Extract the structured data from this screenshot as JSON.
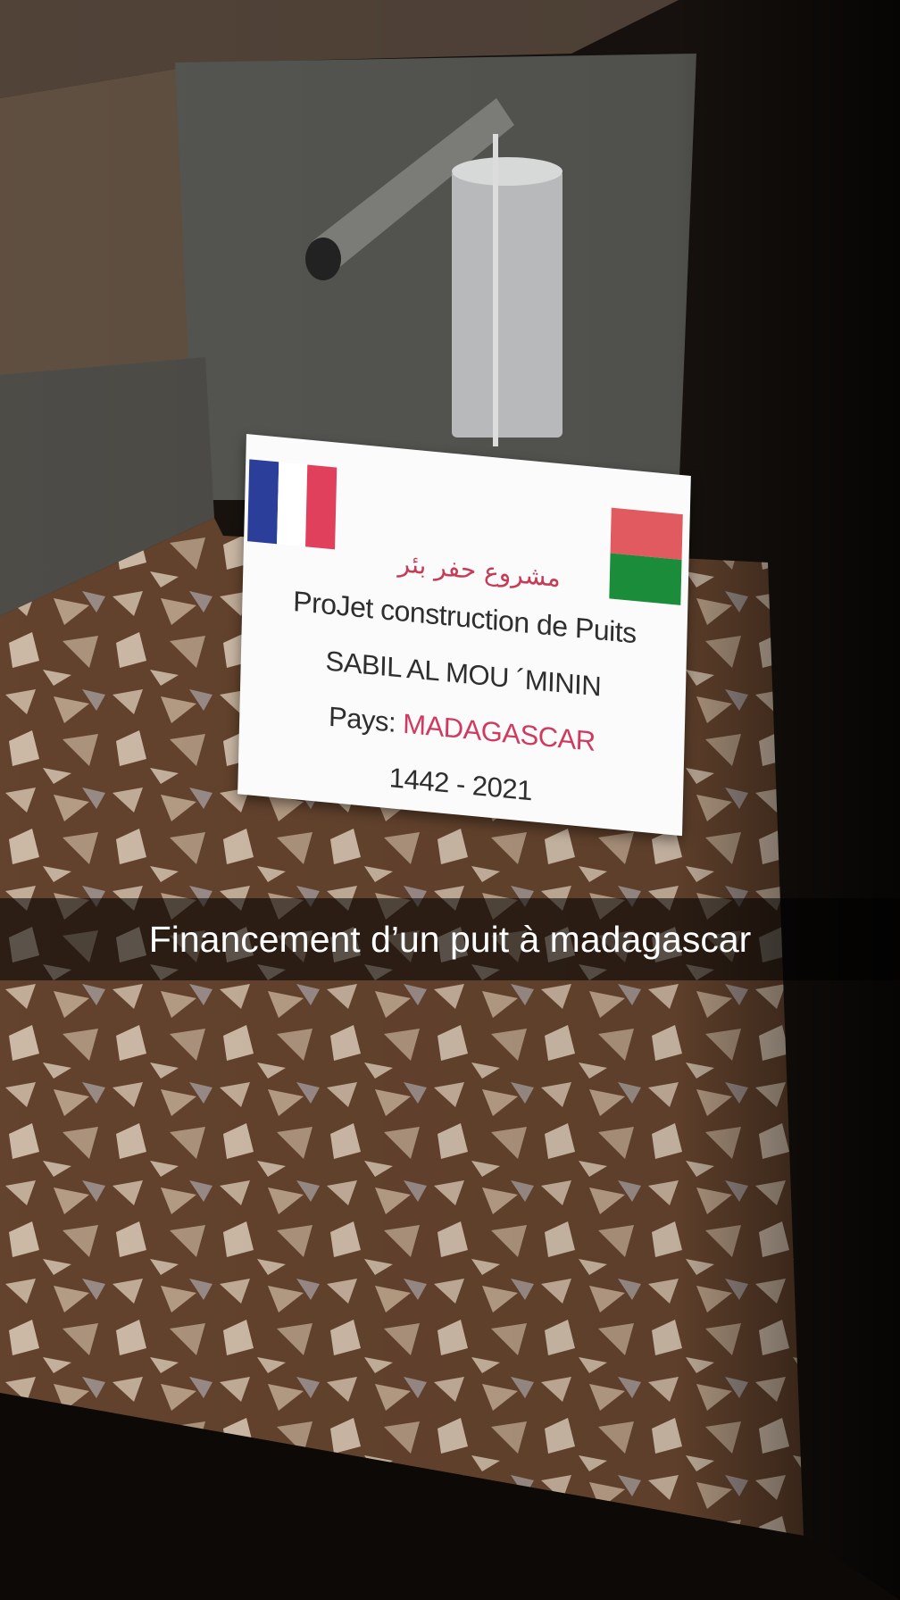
{
  "sign": {
    "arabic_title": "مشروع حفر بئر",
    "project_line": "ProJet construction de Puits",
    "name_line": "SABIL AL MOU ´MININ",
    "country_label": "Pays:",
    "country_value": "MADAGASCAR",
    "years": "1442 - 2021"
  },
  "caption": {
    "text": "Financement d’un puit à madagascar"
  },
  "colors": {
    "france_blue": "#2b3f9a",
    "france_white": "#ffffff",
    "france_red": "#e0405c",
    "madagascar_white": "#ffffff",
    "madagascar_red": "#e05a5f",
    "madagascar_green": "#1a8c3a",
    "caption_text": "#ffffff"
  }
}
